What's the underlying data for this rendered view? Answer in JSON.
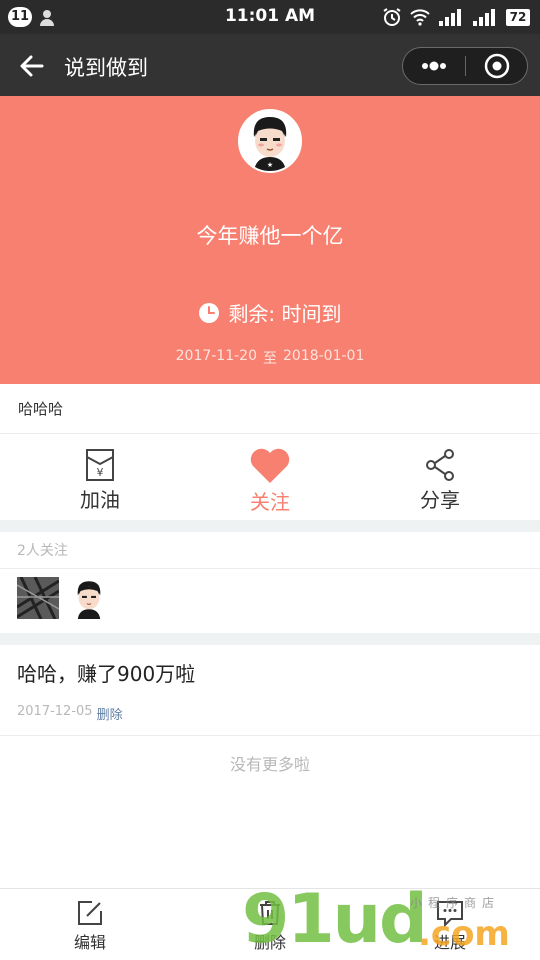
{
  "status_bar": {
    "notification_count": "11",
    "time": "11:01 AM",
    "battery": "72"
  },
  "nav": {
    "title": "说到做到"
  },
  "goal": {
    "title": "今年赚他一个亿",
    "remaining": "剩余: 时间到",
    "start_date": "2017-11-20",
    "date_sep": "至",
    "end_date": "2018-01-01",
    "description": "哈哈哈"
  },
  "actions": {
    "cheer_label": "加油",
    "follow_label": "关注",
    "share_label": "分享"
  },
  "followers": {
    "count_label": "2人关注"
  },
  "post": {
    "text": "哈哈，赚了900万啦",
    "date": "2017-12-05",
    "delete_label": "删除"
  },
  "list": {
    "end_label": "没有更多啦"
  },
  "tabbar": {
    "edit_label": "编辑",
    "delete_label": "删除",
    "progress_label": "进展"
  },
  "watermark": {
    "brand": "91ud",
    "tld": ".com",
    "tagline": "小程序商店"
  },
  "colors": {
    "accent": "#f88070",
    "navbar": "#333333",
    "link": "#5f7fa4",
    "muted": "#b8b8b8"
  },
  "icons": [
    "back-arrow-icon",
    "more-dots-icon",
    "close-circle-icon",
    "clock-icon",
    "cheer-card-icon",
    "heart-icon",
    "share-icon",
    "edit-icon",
    "trash-icon",
    "progress-chat-icon"
  ]
}
